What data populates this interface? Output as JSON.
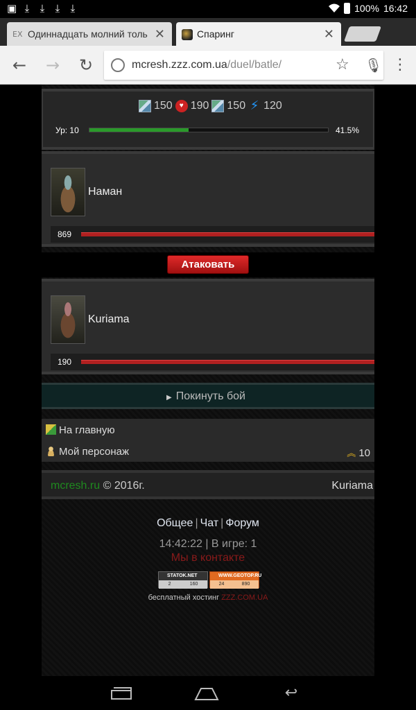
{
  "status_bar": {
    "battery": "100%",
    "time": "16:42"
  },
  "tabs": [
    {
      "favicon": "EX",
      "title": "Одиннадцать молний толь",
      "close": "✕"
    },
    {
      "favicon": "",
      "title": "Спаринг",
      "close": "✕"
    }
  ],
  "toolbar": {
    "url_host": "mcresh.zzz.com.ua",
    "url_path": "/duel/batle/"
  },
  "stats": {
    "val1": "150",
    "hp": "190",
    "val3": "150",
    "energy": "120",
    "level_label": "Ур: 10",
    "xp_percent": "41.5%",
    "xp_fraction": 0.415
  },
  "fighters": [
    {
      "name": "Наман",
      "hp": "869"
    },
    {
      "name": "Kuriama",
      "hp": "190"
    }
  ],
  "attack_label": "Атаковать",
  "leave_label": "Покинуть бой",
  "menu": {
    "home": "На главную",
    "character": "Мой персонаж",
    "rank_value": "10"
  },
  "footer": {
    "site_link": "mcresh.ru",
    "copyright": "© 2016г.",
    "username": "Kuriama"
  },
  "links": {
    "general": "Общее",
    "chat": "Чат",
    "forum": "Форум",
    "sep": "|"
  },
  "time_line": "14:42:22 | В игре: 1",
  "vk_line": "Мы в контакте",
  "counters": [
    {
      "title": "STATOK.NET",
      "a": "2",
      "b": "160"
    },
    {
      "title": "WWW.GEOTOP.RU",
      "a": "24",
      "b": "890"
    }
  ],
  "hosting": {
    "text": "бесплатный хостинг",
    "brand": "ZZZ.COM.UA"
  },
  "colors": {
    "accent_red": "#b02020",
    "xp_green": "#2a9a2a",
    "site_link_green": "#1f8a1f"
  }
}
